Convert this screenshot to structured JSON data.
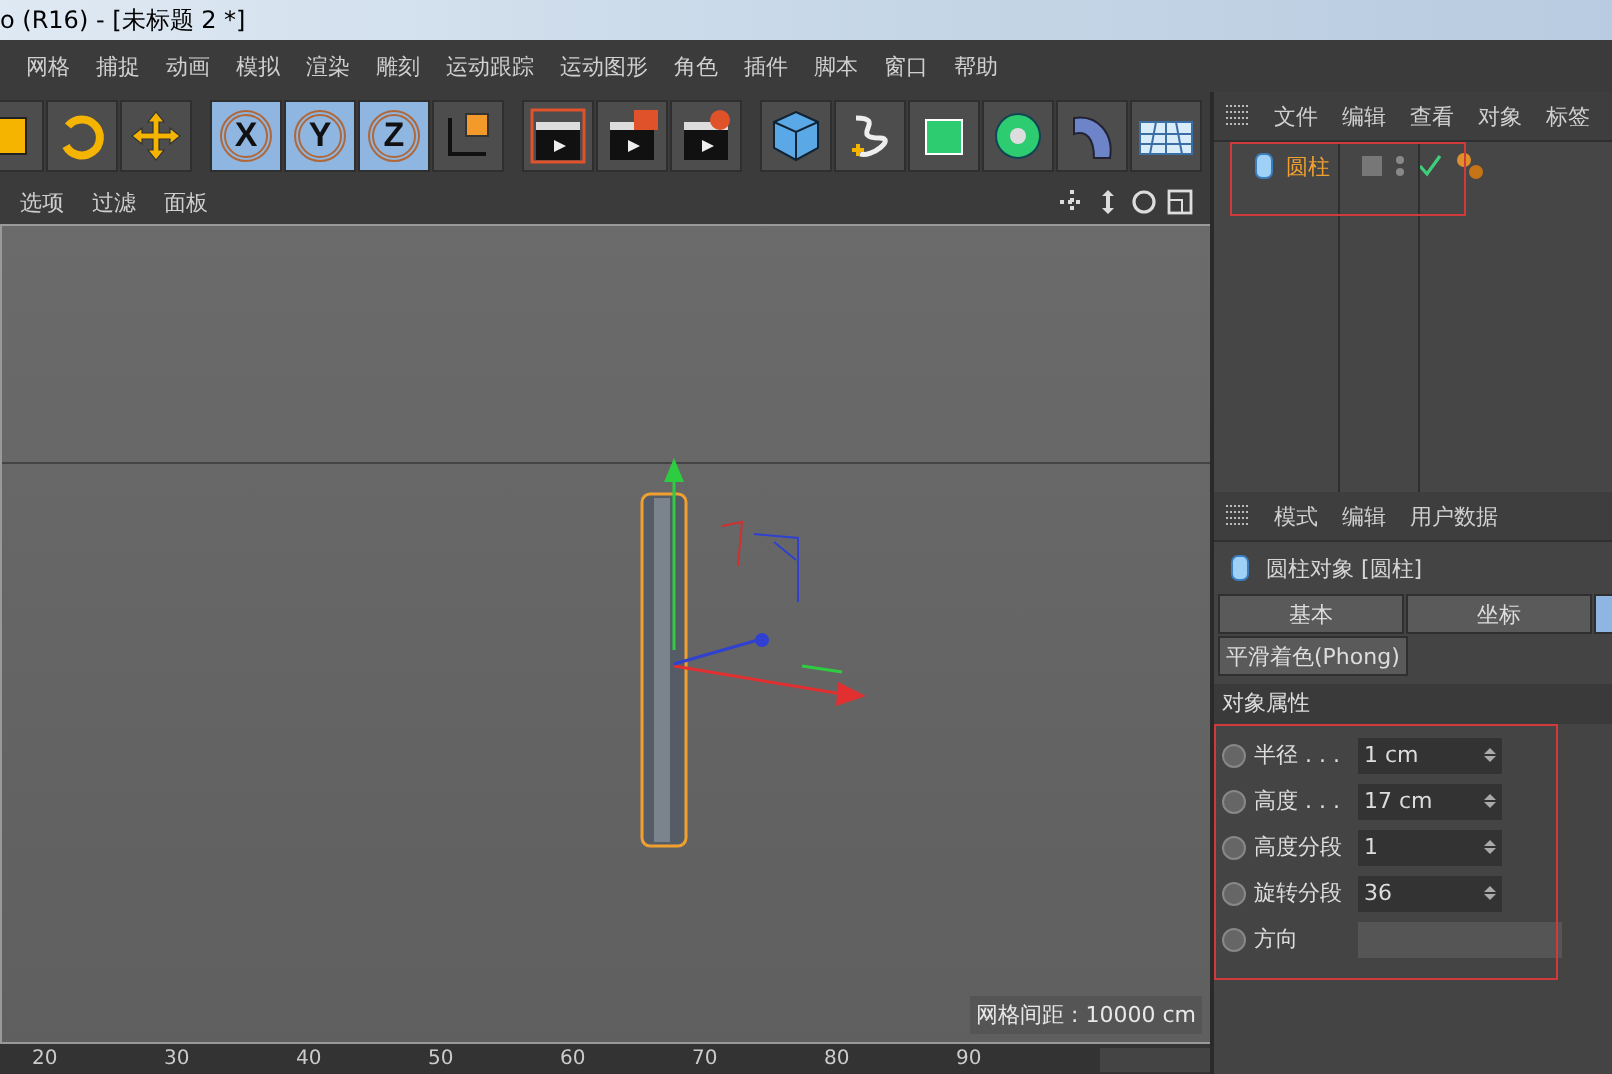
{
  "window": {
    "title": "o (R16) - [未标题 2 *]"
  },
  "menu": [
    "网格",
    "捕捉",
    "动画",
    "模拟",
    "渲染",
    "雕刻",
    "运动跟踪",
    "运动图形",
    "角色",
    "插件",
    "脚本",
    "窗口",
    "帮助"
  ],
  "toolbar": [
    {
      "kind": "scale"
    },
    {
      "kind": "rotate"
    },
    {
      "kind": "move"
    },
    {
      "kind": "axis",
      "label": "X",
      "selected": true
    },
    {
      "kind": "axis",
      "label": "Y",
      "selected": true
    },
    {
      "kind": "axis",
      "label": "Z",
      "selected": true
    },
    {
      "kind": "coords"
    },
    {
      "kind": "render-region"
    },
    {
      "kind": "render"
    },
    {
      "kind": "render-settings"
    },
    {
      "kind": "cube"
    },
    {
      "kind": "pen"
    },
    {
      "kind": "subdivision"
    },
    {
      "kind": "cloner"
    },
    {
      "kind": "bend"
    },
    {
      "kind": "floor"
    }
  ],
  "viewport": {
    "menu": [
      "选项",
      "过滤",
      "面板"
    ],
    "grid_spacing": "网格间距 : 10000 cm"
  },
  "timeline": {
    "ticks": [
      "20",
      "30",
      "40",
      "50",
      "60",
      "70",
      "80",
      "90"
    ]
  },
  "object_manager": {
    "menu": [
      "文件",
      "编辑",
      "查看",
      "对象",
      "标签"
    ],
    "objects": [
      {
        "name": "圆柱",
        "selected": true,
        "enabled": true
      }
    ]
  },
  "attributes": {
    "menu": [
      "模式",
      "编辑",
      "用户数据"
    ],
    "header": "圆柱对象 [圆柱]",
    "tabs": [
      {
        "label": "基本",
        "selected": false
      },
      {
        "label": "坐标",
        "selected": false
      },
      {
        "selected": true
      }
    ],
    "subtab": "平滑着色(Phong)",
    "section": "对象属性",
    "fields": [
      {
        "kind": "number",
        "label": "半径 . . .",
        "value": "1 cm",
        "keyframed": false
      },
      {
        "kind": "number",
        "label": "高度 . . .",
        "value": "17 cm",
        "keyframed": false
      },
      {
        "kind": "number",
        "label": "高度分段",
        "value": "1",
        "keyframed": false
      },
      {
        "kind": "number",
        "label": "旋转分段",
        "value": "36",
        "keyframed": false
      },
      {
        "kind": "dropdown",
        "label": "方向",
        "keyframed": false
      }
    ]
  }
}
